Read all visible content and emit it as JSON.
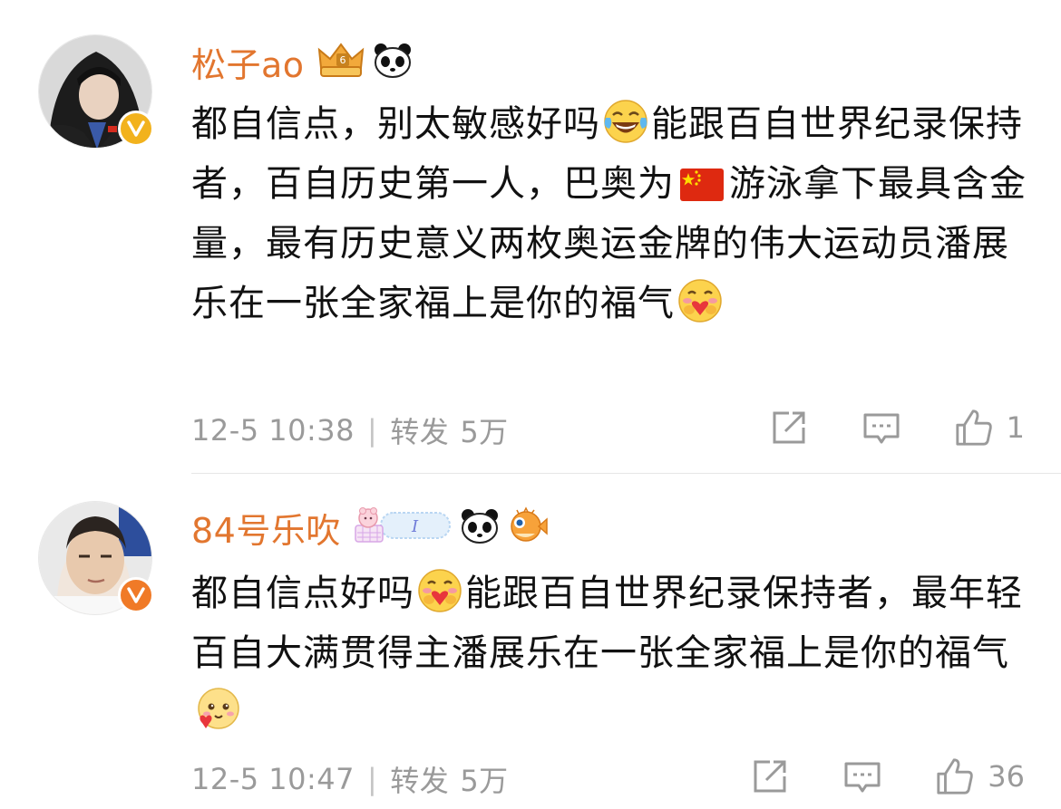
{
  "comments": [
    {
      "username": "松子ao",
      "verified_color": "#f2b21d",
      "badges": [
        "crown-badge-icon",
        "panda-icon"
      ],
      "text_segments": [
        "都自信点，别太敏感好吗",
        "能跟百自世界纪录保持者，百自历史第一人，巴奥为",
        "游泳拿下最具含金量，最有历史意义两枚奥运金牌的伟大运动员潘展乐在一张全家福上是你的福气"
      ],
      "emojis": [
        "laugh-cry-emoji",
        "china-flag-icon",
        "hug-heart-emoji"
      ],
      "time": "12-5 10:38",
      "repost_label": "转发",
      "repost_count": "5万",
      "like_count": "1"
    },
    {
      "username": "84号乐吹",
      "verified_color": "#f07a27",
      "badges": [
        "pink-badge-icon",
        "panda-icon",
        "pufferfish-icon"
      ],
      "badge_text": "I",
      "text_segments": [
        "都自信点好吗",
        "能跟百自世界纪录保持者，最年轻百自大满贯得主潘展乐在一张全家福上是你的福气"
      ],
      "emojis": [
        "hug-heart-emoji",
        "shy-heart-emoji"
      ],
      "time": "12-5 10:47",
      "repost_label": "转发",
      "repost_count": "5万",
      "like_count": "36"
    }
  ],
  "colors": {
    "username": "#e2762f",
    "meta": "#9a9a9a",
    "divider": "#e6e6e6"
  }
}
